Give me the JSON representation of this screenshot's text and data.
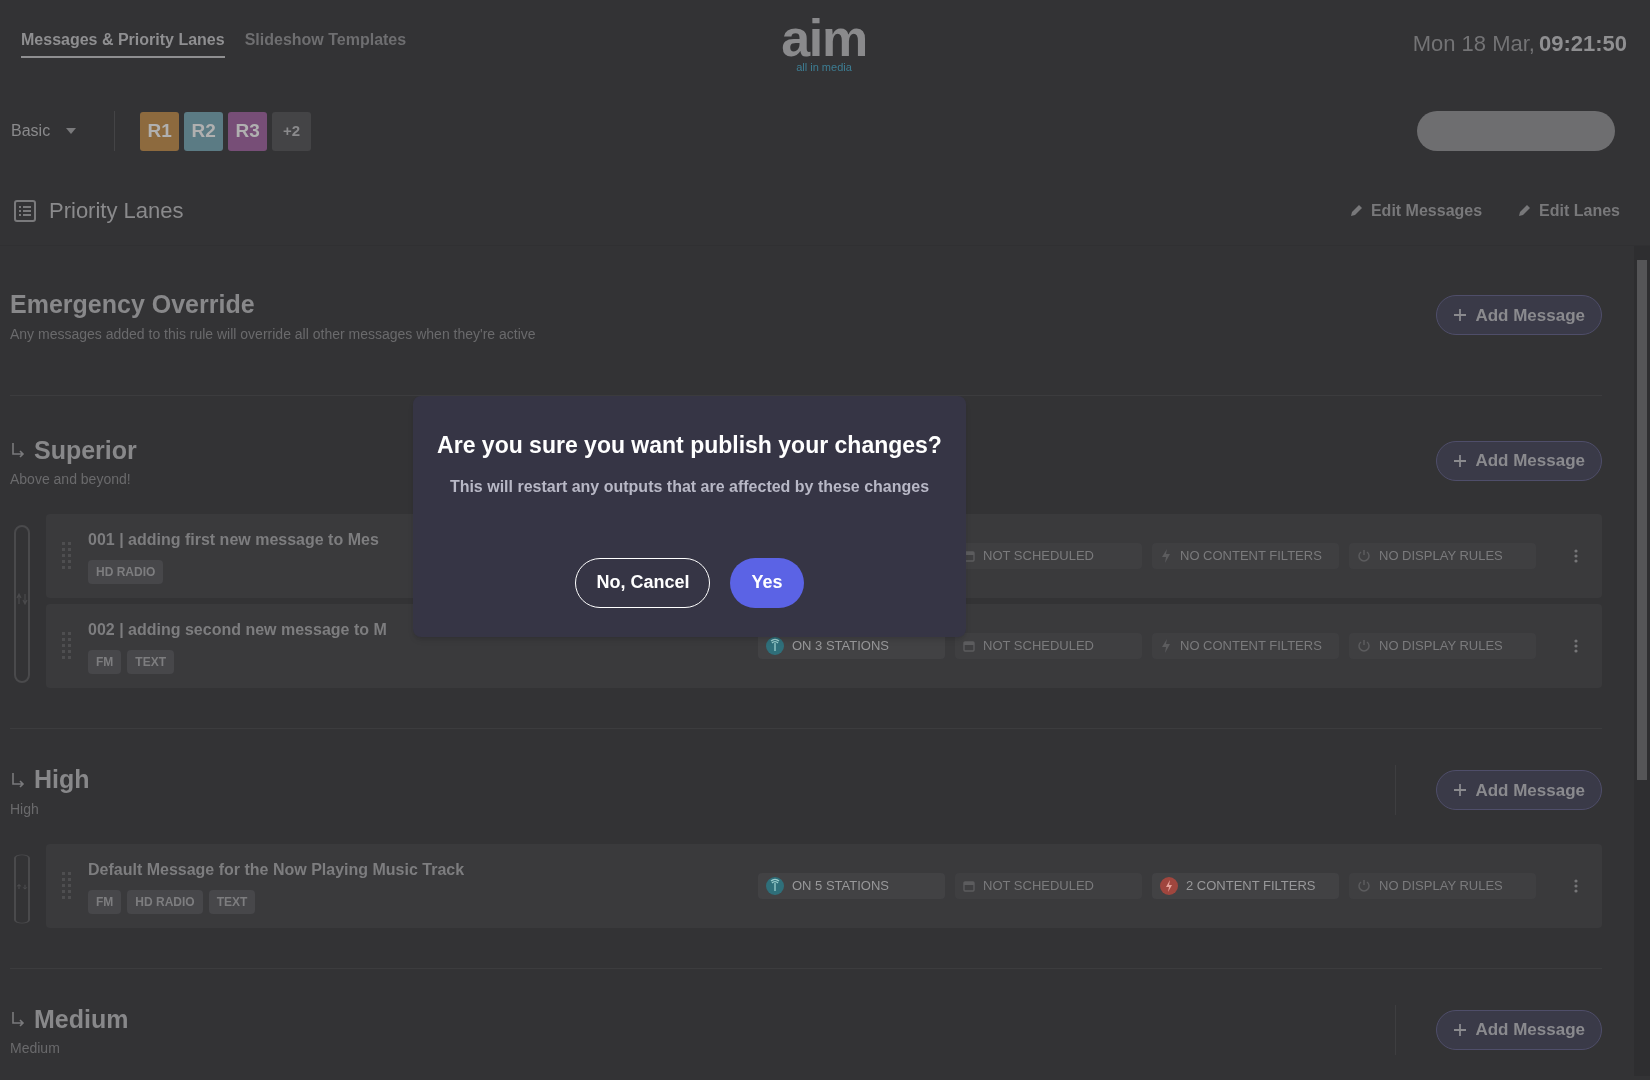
{
  "header": {
    "tabs": [
      {
        "label": "Messages & Priority Lanes",
        "selected": true
      },
      {
        "label": "Slideshow Templates",
        "selected": false
      }
    ],
    "logo": {
      "wordmark": "aim",
      "tagline": "all in media"
    },
    "date": "Mon 18 Mar,",
    "time": "09:21:50"
  },
  "toolbar": {
    "view": "Basic",
    "regions": [
      {
        "label": "R1",
        "color": "#8d6a3e"
      },
      {
        "label": "R2",
        "color": "#5b7b84"
      },
      {
        "label": "R3",
        "color": "#774e77"
      }
    ],
    "more": "+2"
  },
  "section": {
    "title": "Priority Lanes",
    "actions": [
      "Edit Messages",
      "Edit Lanes"
    ]
  },
  "lanes": [
    {
      "title": "Emergency Override",
      "subtitle": "Any messages added to this rule will override all other messages when they're active",
      "add_label": "Add Message",
      "arrow": false
    },
    {
      "title": "Superior",
      "subtitle": "Above and beyond!",
      "add_label": "Add Message",
      "arrow": true,
      "messages": [
        {
          "title": "001 | adding first new message to Mes",
          "tags": [
            "HD RADIO"
          ],
          "chips": [
            {
              "kind": "schedule",
              "label": "NOT SCHEDULED",
              "active": false
            },
            {
              "kind": "filters",
              "label": "NO CONTENT FILTERS",
              "active": false
            },
            {
              "kind": "display",
              "label": "NO DISPLAY RULES",
              "active": false
            }
          ]
        },
        {
          "title": "002 | adding second new message to M",
          "tags": [
            "FM",
            "TEXT"
          ],
          "chips": [
            {
              "kind": "stations",
              "label": "ON 3 STATIONS",
              "active": true
            },
            {
              "kind": "schedule",
              "label": "NOT SCHEDULED",
              "active": false
            },
            {
              "kind": "filters",
              "label": "NO CONTENT FILTERS",
              "active": false
            },
            {
              "kind": "display",
              "label": "NO DISPLAY RULES",
              "active": false
            }
          ]
        }
      ]
    },
    {
      "title": "High",
      "subtitle": "High",
      "add_label": "Add Message",
      "arrow": true,
      "messages": [
        {
          "title": "Default Message for the Now Playing Music Track",
          "tags": [
            "FM",
            "HD RADIO",
            "TEXT"
          ],
          "chips": [
            {
              "kind": "stations",
              "label": "ON 5 STATIONS",
              "active": true
            },
            {
              "kind": "schedule",
              "label": "NOT SCHEDULED",
              "active": false
            },
            {
              "kind": "filters",
              "label": "2 CONTENT FILTERS",
              "active": true
            },
            {
              "kind": "display",
              "label": "NO DISPLAY RULES",
              "active": false
            }
          ]
        }
      ]
    },
    {
      "title": "Medium",
      "subtitle": "Medium",
      "add_label": "Add Message",
      "arrow": true
    }
  ],
  "dialog": {
    "title": "Are you sure you want publish your changes?",
    "message": "This will restart any outputs that are affected by these changes",
    "buttons": [
      {
        "label": "No, Cancel",
        "kind": "secondary"
      },
      {
        "label": "Yes",
        "kind": "primary"
      }
    ]
  }
}
